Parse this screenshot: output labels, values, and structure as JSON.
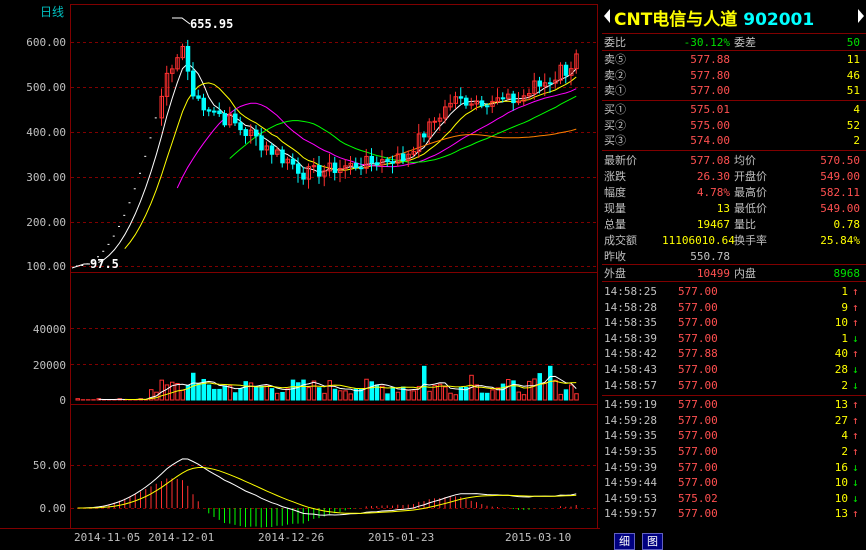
{
  "chart": {
    "period_label": "日线",
    "price_axis_labels": [
      "600.00",
      "500.00",
      "400.00",
      "300.00",
      "200.00",
      "100.00"
    ],
    "volume_axis_labels": [
      "40000",
      "20000",
      "0"
    ],
    "macd_axis_labels": [
      "50.00",
      "0.00"
    ],
    "date_labels": [
      "2014-11-05",
      "2014-12-01",
      "2014-12-26",
      "2015-01-23",
      "2015-03-10"
    ],
    "high_annotation": "655.95",
    "low_annotation": "97.5",
    "colors": {
      "up": "#ff3030",
      "down": "#00ffff",
      "ma5": "#ffffff",
      "ma10": "#ffff00",
      "ma20": "#ff00ff",
      "ma30": "#00ff00",
      "ma60": "#ff8000",
      "grid": "#800000"
    }
  },
  "stock": {
    "name": "CNT电信与人道",
    "code": "902001"
  },
  "order_book": {
    "weibi_label": "委比",
    "weibi_value": "-30.12%",
    "weicha_label": "委差",
    "weicha_value": "50",
    "asks": [
      {
        "label": "卖⑤",
        "price": "577.88",
        "volume": "11"
      },
      {
        "label": "卖②",
        "price": "577.80",
        "volume": "46"
      },
      {
        "label": "卖①",
        "price": "577.00",
        "volume": "51"
      }
    ],
    "bids": [
      {
        "label": "买①",
        "price": "575.01",
        "volume": "4"
      },
      {
        "label": "买②",
        "price": "575.00",
        "volume": "52"
      },
      {
        "label": "买③",
        "price": "574.00",
        "volume": "2"
      }
    ]
  },
  "quote": {
    "rows": [
      {
        "l1": "最新价",
        "v1": "577.08",
        "l2": "均价",
        "v2": "570.50"
      },
      {
        "l1": "涨跌",
        "v1": "26.30",
        "l2": "开盘价",
        "v2": "549.00"
      },
      {
        "l1": "幅度",
        "v1": "4.78%",
        "l2": "最高价",
        "v2": "582.11"
      },
      {
        "l1": "现量",
        "v1": "13",
        "l2": "最低价",
        "v2": "549.00"
      },
      {
        "l1": "总量",
        "v1": "19467",
        "l2": "量比",
        "v2": "0.78"
      },
      {
        "l1": "成交额",
        "v1": "11106010.64",
        "l2": "换手率",
        "v2": "25.84%"
      }
    ],
    "prev_close_label": "昨收",
    "prev_close_value": "550.78",
    "outer_label": "外盘",
    "outer_value": "10499",
    "inner_label": "内盘",
    "inner_value": "8968"
  },
  "ticks": [
    {
      "time": "14:58:25",
      "price": "577.00",
      "vol": "1",
      "dir": "up"
    },
    {
      "time": "14:58:28",
      "price": "577.00",
      "vol": "9",
      "dir": "up"
    },
    {
      "time": "14:58:35",
      "price": "577.00",
      "vol": "10",
      "dir": "up"
    },
    {
      "time": "14:58:39",
      "price": "577.00",
      "vol": "1",
      "dir": "down"
    },
    {
      "time": "14:58:42",
      "price": "577.88",
      "vol": "40",
      "dir": "up"
    },
    {
      "time": "14:58:43",
      "price": "577.00",
      "vol": "28",
      "dir": "down"
    },
    {
      "time": "14:58:57",
      "price": "577.00",
      "vol": "2",
      "dir": "down"
    },
    {
      "time": "14:59:19",
      "price": "577.00",
      "vol": "13",
      "dir": "up"
    },
    {
      "time": "14:59:28",
      "price": "577.00",
      "vol": "27",
      "dir": "up"
    },
    {
      "time": "14:59:35",
      "price": "577.00",
      "vol": "4",
      "dir": "up"
    },
    {
      "time": "14:59:35",
      "price": "577.00",
      "vol": "2",
      "dir": "up"
    },
    {
      "time": "14:59:39",
      "price": "577.00",
      "vol": "16",
      "dir": "down"
    },
    {
      "time": "14:59:44",
      "price": "577.00",
      "vol": "10",
      "dir": "down"
    },
    {
      "time": "14:59:53",
      "price": "575.02",
      "vol": "10",
      "dir": "down"
    },
    {
      "time": "14:59:57",
      "price": "577.00",
      "vol": "13",
      "dir": "up"
    }
  ],
  "tabs": {
    "detail": "细",
    "chart": "图"
  }
}
